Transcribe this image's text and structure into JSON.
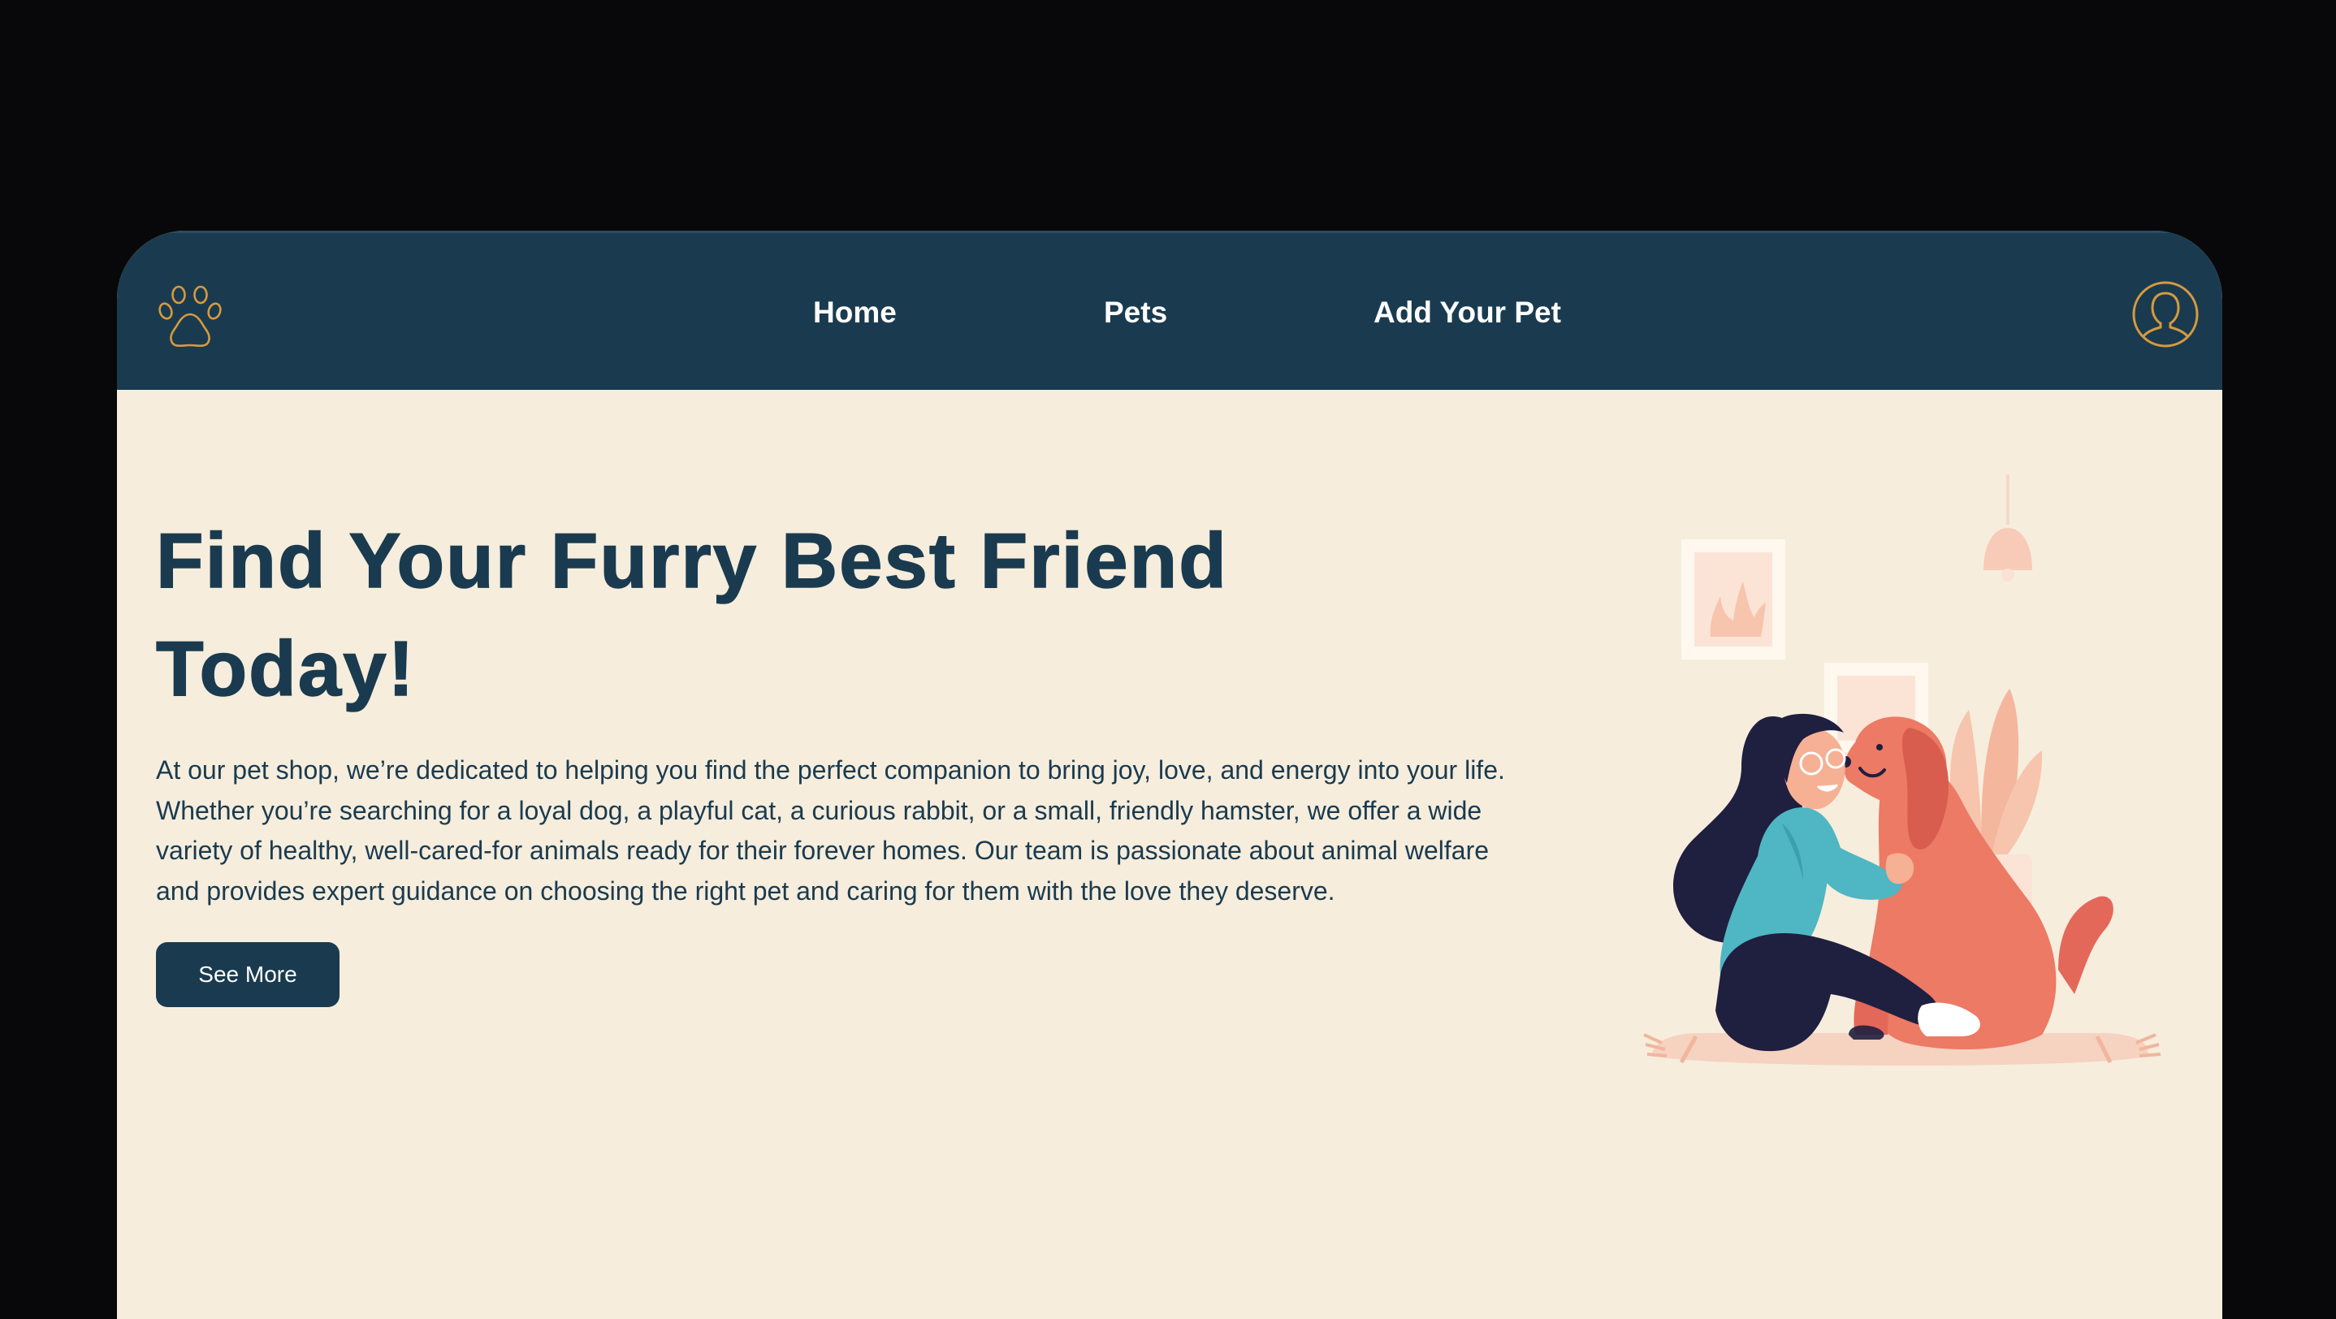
{
  "navbar": {
    "logo_icon": "paw-icon",
    "links": [
      {
        "label": "Home"
      },
      {
        "label": "Pets"
      },
      {
        "label": "Add Your Pet"
      }
    ],
    "profile_icon": "user-icon"
  },
  "hero": {
    "title": "Find Your Furry Best Friend Today!",
    "description": "At our pet shop, we’re dedicated to helping you find the perfect companion to bring joy, love, and energy into your life. Whether you’re searching for a loyal dog, a playful cat, a curious rabbit, or a small, friendly hamster, we offer a wide variety of healthy, well-cared-for animals ready for their forever homes. Our team is passionate about animal welfare and provides expert guidance on choosing the right pet and caring for them with the love they deserve.",
    "button_label": "See More",
    "illustration": "woman-hugging-dog-illustration"
  },
  "colors": {
    "navbar": "#1a3b4f",
    "accent": "#d79a3e",
    "background": "#f6eddd",
    "text": "#1a3b4f"
  }
}
